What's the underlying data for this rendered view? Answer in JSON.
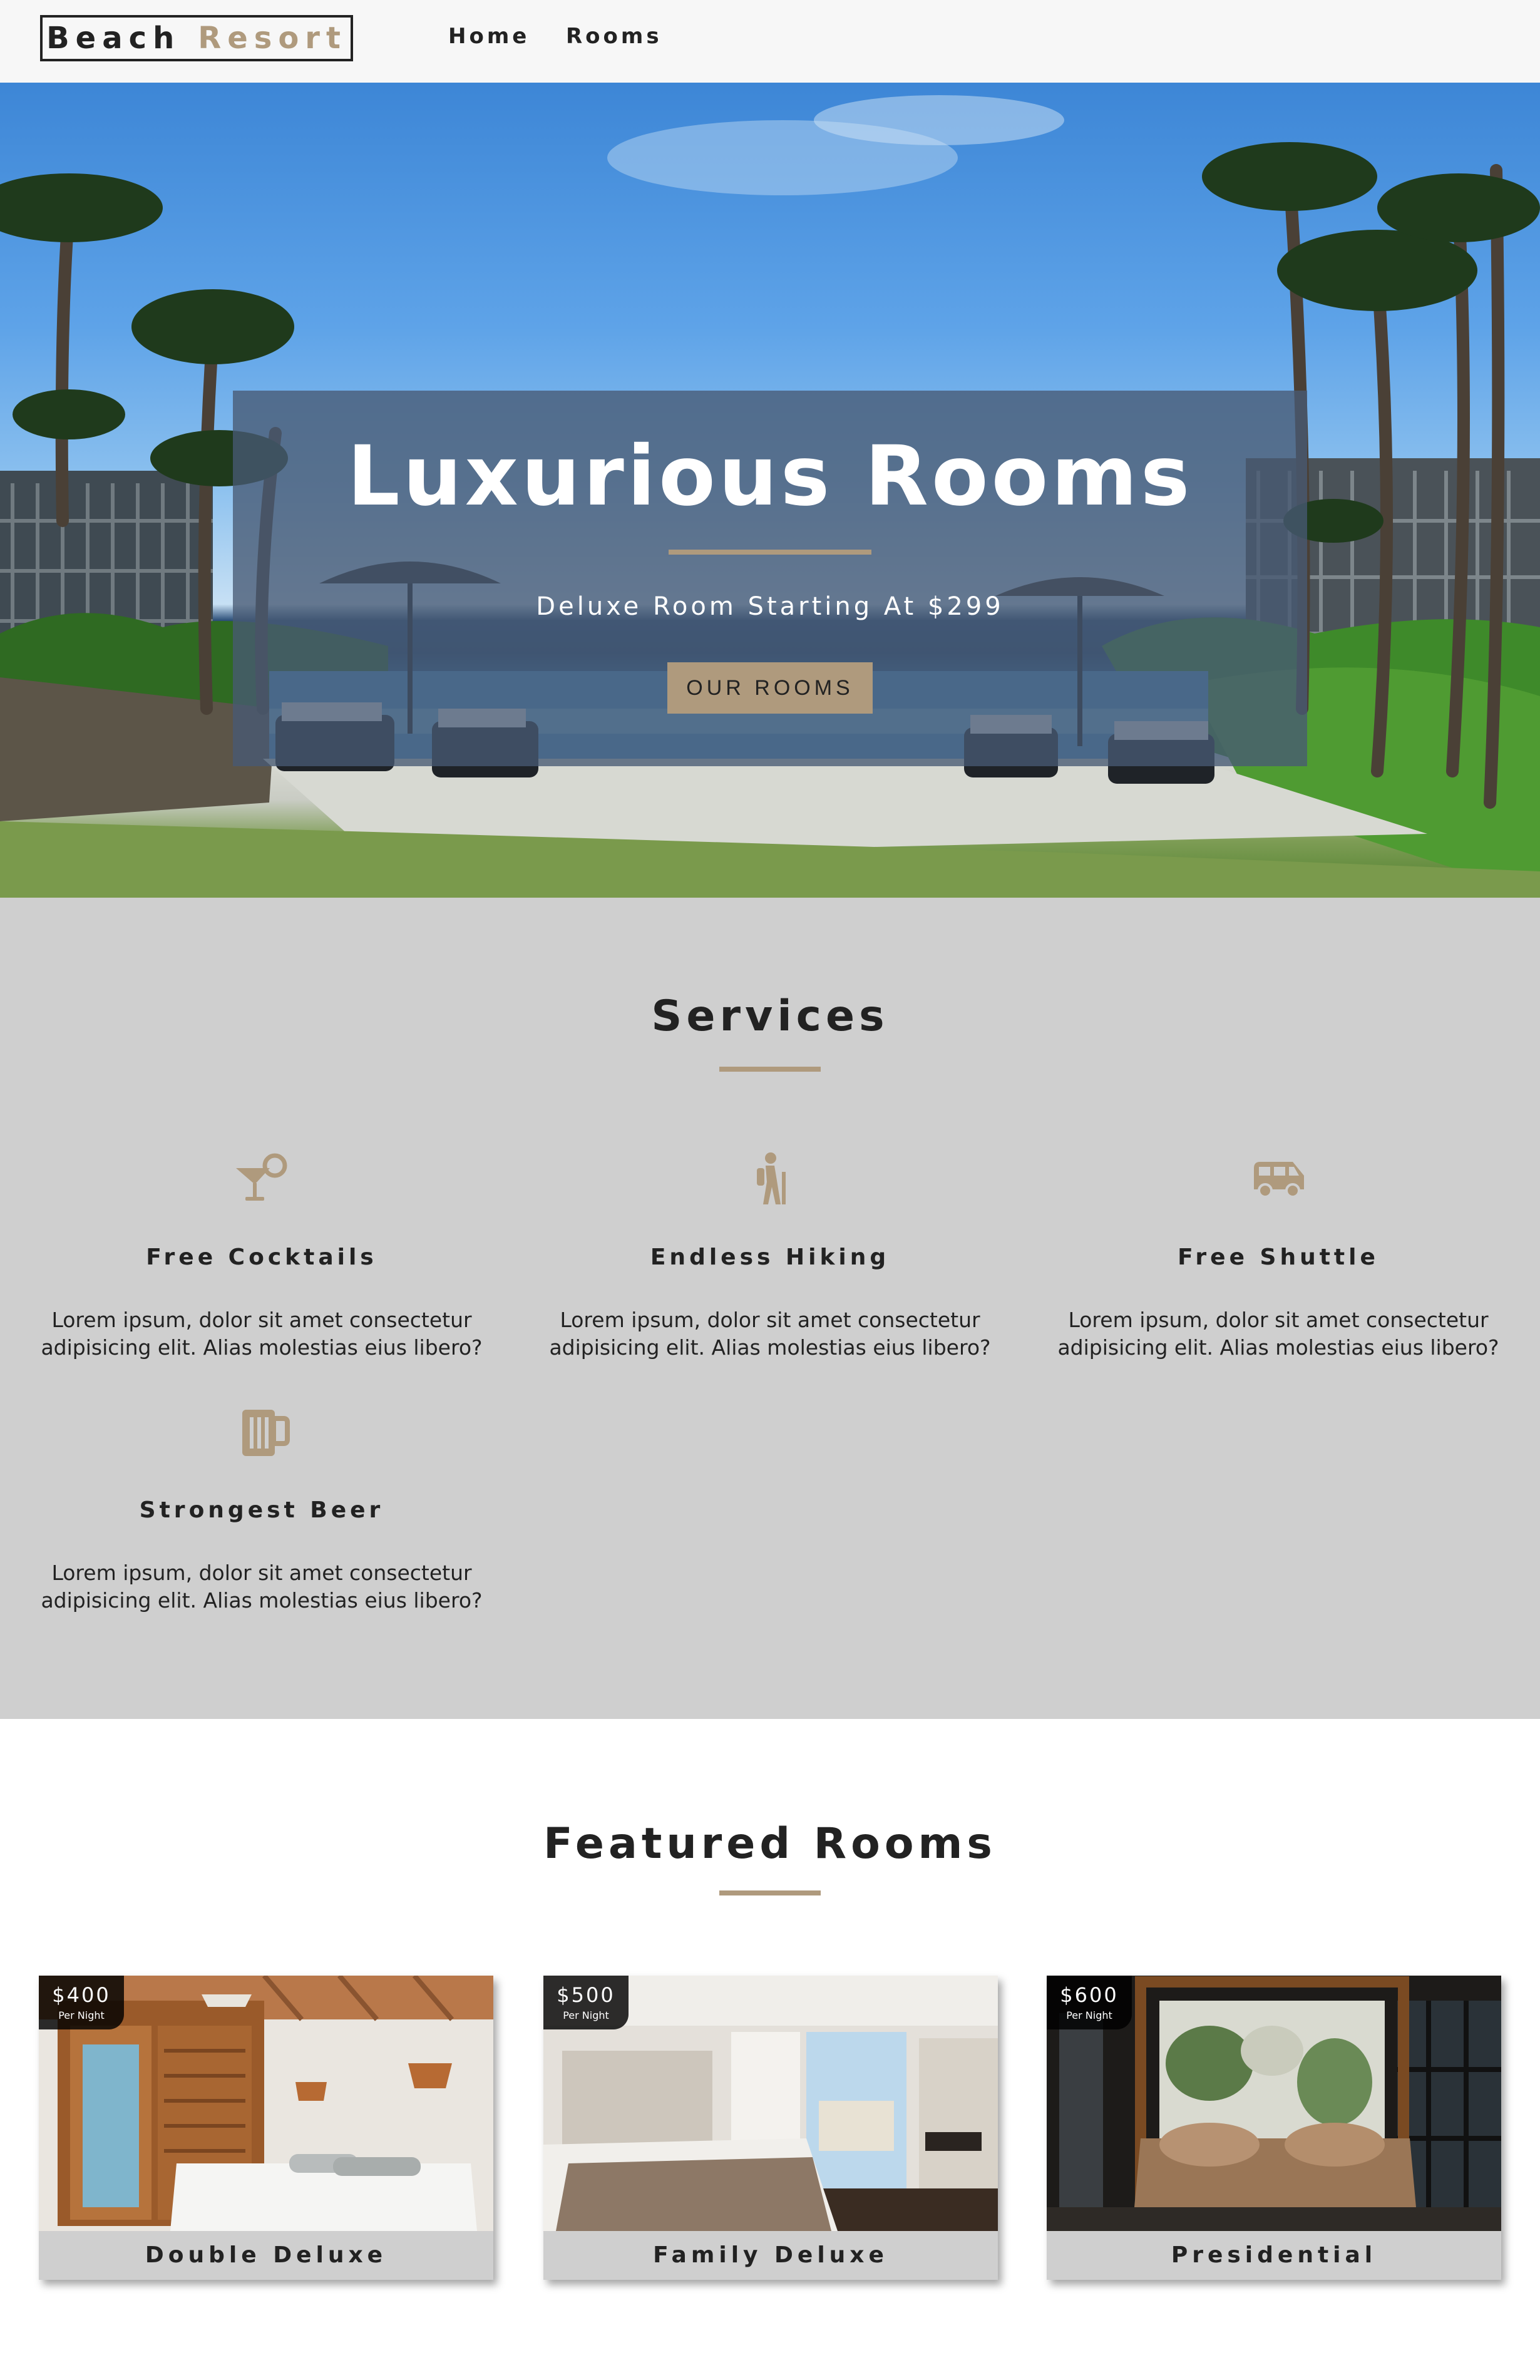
{
  "navbar": {
    "logo_part1": "Beach",
    "logo_part2": "Resort",
    "links": [
      "Home",
      "Rooms"
    ]
  },
  "hero": {
    "title": "Luxurious Rooms",
    "subtitle": "Deluxe Room Starting At $299",
    "button_label": "OUR ROOMS"
  },
  "services": {
    "title": "Services",
    "items": [
      {
        "icon": "cocktail-icon",
        "title": "Free Cocktails",
        "text": "Lorem ipsum, dolor sit amet consectetur adipisicing elit. Alias molestias eius libero?"
      },
      {
        "icon": "hiking-icon",
        "title": "Endless Hiking",
        "text": "Lorem ipsum, dolor sit amet consectetur adipisicing elit. Alias molestias eius libero?"
      },
      {
        "icon": "shuttle-icon",
        "title": "Free Shuttle",
        "text": "Lorem ipsum, dolor sit amet consectetur adipisicing elit. Alias molestias eius libero?"
      },
      {
        "icon": "beer-icon",
        "title": "Strongest Beer",
        "text": "Lorem ipsum, dolor sit amet consectetur adipisicing elit. Alias molestias eius libero?"
      }
    ]
  },
  "featured": {
    "title": "Featured Rooms",
    "rooms": [
      {
        "name": "Double Deluxe",
        "price": "$400",
        "per": "Per Night"
      },
      {
        "name": "Family Deluxe",
        "price": "$500",
        "per": "Per Night"
      },
      {
        "name": "Presidential",
        "price": "$600",
        "per": "Per Night"
      }
    ]
  },
  "colors": {
    "accent": "#af9a7d",
    "dark": "#222222",
    "services_bg": "#cfcfcf",
    "navbar_bg": "#f7f7f7"
  }
}
